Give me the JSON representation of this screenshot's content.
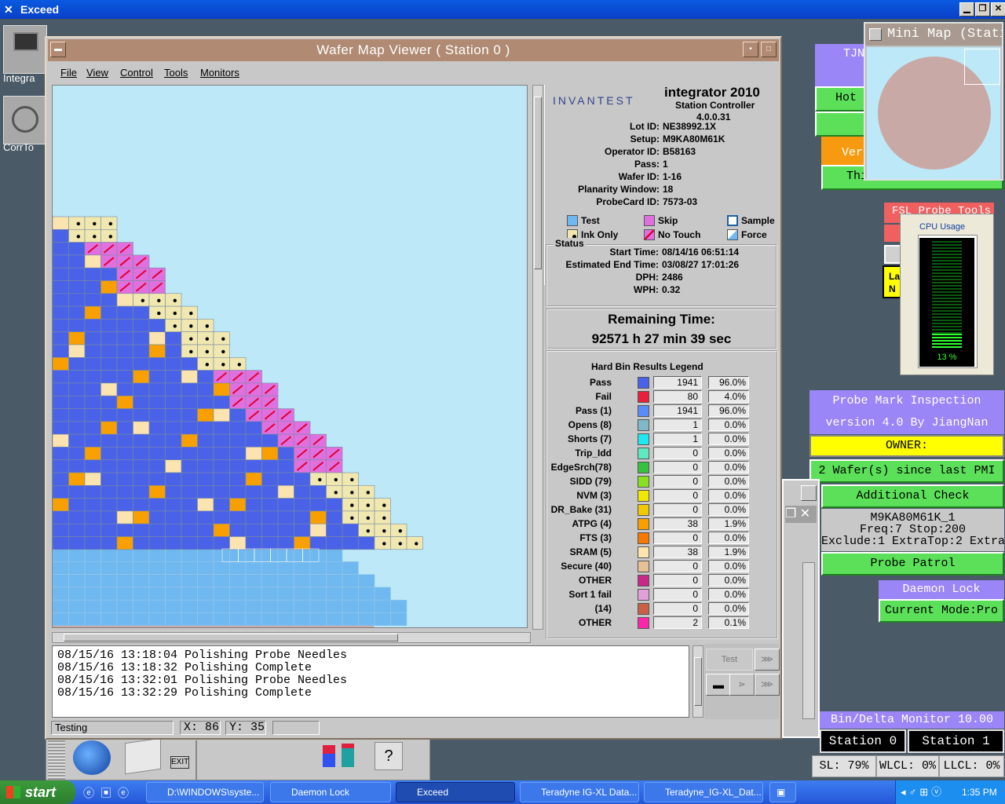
{
  "exceed": {
    "title": "Exceed"
  },
  "desktop_icons": [
    {
      "label": "Integra"
    },
    {
      "label": "CorrTo"
    }
  ],
  "window": {
    "title": "Wafer Map Viewer ( Station 0 )",
    "menu": [
      "File",
      "View",
      "Control",
      "Tools",
      "Monitors"
    ]
  },
  "info": {
    "brand": "INVANTEST",
    "product": "integrator 2010",
    "subtitle": "Station Controller",
    "version": "4.0.0.31",
    "fields": [
      {
        "label": "Lot ID:",
        "value": "NE38992.1X"
      },
      {
        "label": "Setup:",
        "value": "M9KA80M61K"
      },
      {
        "label": "Operator ID:",
        "value": "B58163"
      },
      {
        "label": "Pass:",
        "value": "1"
      },
      {
        "label": "Wafer ID:",
        "value": "1-16"
      },
      {
        "label": "Planarity Window:",
        "value": "18"
      },
      {
        "label": "ProbeCard ID:",
        "value": "7573-03"
      }
    ],
    "legend": [
      {
        "label": "Test",
        "color": "#6fb8f0"
      },
      {
        "label": "Skip",
        "color": "#e070e0"
      },
      {
        "label": "Sample",
        "color": "#ffffff"
      },
      {
        "label": "Ink Only",
        "color": "#f0e8b0"
      },
      {
        "label": "No Touch",
        "color": "#e070e0"
      },
      {
        "label": "Force",
        "color": "#ffffff"
      }
    ]
  },
  "status": {
    "title": "Status",
    "fields": [
      {
        "label": "Start Time:",
        "value": "08/14/16 06:51:14"
      },
      {
        "label": "Estimated End Time:",
        "value": "03/08/27 17:01:26"
      },
      {
        "label": "DPH:",
        "value": "2486"
      },
      {
        "label": "WPH:",
        "value": "0.32"
      }
    ]
  },
  "remaining": {
    "label": "Remaining Time:",
    "value": "92571 h 27 min 39 sec"
  },
  "hardbin": {
    "title": "Hard Bin Results Legend",
    "rows": [
      {
        "name": "Pass",
        "color": "#4a62e8",
        "count": "1941",
        "pct": "96.0%"
      },
      {
        "name": "Fail",
        "color": "#e8203c",
        "count": "80",
        "pct": "4.0%"
      },
      {
        "name": "Pass      (1)",
        "color": "#5a8cf8",
        "count": "1941",
        "pct": "96.0%"
      },
      {
        "name": "Opens      (8)",
        "color": "#80b8c8",
        "count": "1",
        "pct": "0.0%"
      },
      {
        "name": "Shorts     (7)",
        "color": "#20e8f0",
        "count": "1",
        "pct": "0.0%"
      },
      {
        "name": "Trip_Idd",
        "color": "#60e8c0",
        "count": "0",
        "pct": "0.0%"
      },
      {
        "name": "EdgeSrch(78)",
        "color": "#38c040",
        "count": "0",
        "pct": "0.0%"
      },
      {
        "name": "SIDD      (79)",
        "color": "#88e020",
        "count": "0",
        "pct": "0.0%"
      },
      {
        "name": "NVM       (3)",
        "color": "#f0e800",
        "count": "0",
        "pct": "0.0%"
      },
      {
        "name": "DR_Bake (31)",
        "color": "#f0c800",
        "count": "0",
        "pct": "0.0%"
      },
      {
        "name": "ATPG      (4)",
        "color": "#f8a000",
        "count": "38",
        "pct": "1.9%"
      },
      {
        "name": "FTS        (3)",
        "color": "#f87800",
        "count": "0",
        "pct": "0.0%"
      },
      {
        "name": "SRAM      (5)",
        "color": "#fce4b0",
        "count": "38",
        "pct": "1.9%"
      },
      {
        "name": "Secure   (40)",
        "color": "#e8c098",
        "count": "0",
        "pct": "0.0%"
      },
      {
        "name": "OTHER",
        "color": "#c82888",
        "count": "0",
        "pct": "0.0%"
      },
      {
        "name": "Sort 1 fail",
        "color": "#e0a0d8",
        "count": "0",
        "pct": "0.0%"
      },
      {
        "name": "(14)",
        "color": "#c86048",
        "count": "0",
        "pct": "0.0%"
      },
      {
        "name": "OTHER",
        "color": "#f828a8",
        "count": "2",
        "pct": "0.1%"
      }
    ]
  },
  "log": [
    "08/15/16 13:18:04 Polishing Probe Needles",
    "08/15/16 13:18:32 Polishing Complete",
    "08/15/16 13:32:01 Polishing Probe Needles",
    "08/15/16 13:32:29 Polishing Complete"
  ],
  "controls": {
    "test": "Test"
  },
  "statusbar": {
    "state": "Testing",
    "x": "X: 86",
    "y": "Y: 35"
  },
  "dock": {
    "exit": "EXIT"
  },
  "right": {
    "tjn": "TJN",
    "hot": "Hot",
    "ver": "Ver",
    "thi": "Thi",
    "fsl": "FSL Probe Tools",
    "la": "La",
    "n": "N",
    "pmi_title": "Probe Mark Inspection",
    "pmi_version": "version 4.0 By JiangNan",
    "owner": "OWNER:",
    "wafers": "2 Wafer(s) since last PMI",
    "additional": "Additional Check",
    "setup_line": "M9KA80M61K_1",
    "freq_line": "Freq:7 Stop:200",
    "exclude_line": "Exclude:1 ExtraTop:2 Extra:",
    "patrol": "Probe Patrol",
    "daemon": "Daemon Lock",
    "mode": "Current Mode:Pro",
    "bdm_title": "Bin/Delta Monitor 10.00",
    "station0": "Station 0",
    "station1": "Station 1",
    "sl": "SL: 79%",
    "wlcl": "WLCL: 0%",
    "llcl": "LLCL: 0%"
  },
  "minimap": {
    "title": "Mini Map (Station"
  },
  "cpu": {
    "title": "CPU Usage",
    "value": "13 %",
    "level": 0.13
  },
  "taskbar": {
    "start": "start",
    "items": [
      "D:\\WINDOWS\\syste...",
      "Daemon Lock",
      "Exceed",
      "Teradyne IG-XL Data...",
      "Teradyne_IG-XL_Dat..."
    ],
    "clock": "1:35 PM"
  },
  "colors": {
    "pass": "#4a62e8",
    "ink": "#f0e8b0",
    "skip": "#e070e0",
    "test": "#6fb8f0",
    "atpg": "#f8a000"
  }
}
